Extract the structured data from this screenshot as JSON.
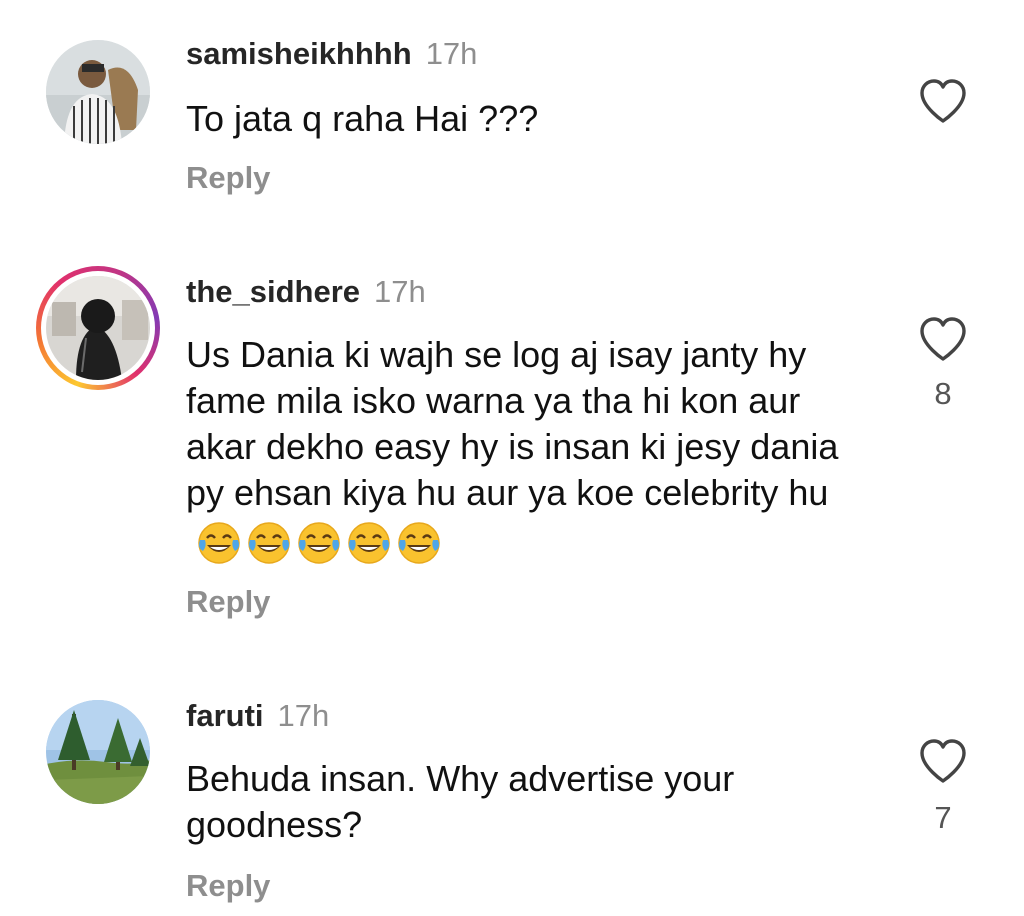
{
  "comments": [
    {
      "username": "samisheikhhhh",
      "time": "17h",
      "text": "To jata q raha Hai ???",
      "reply": "Reply",
      "likes": ""
    },
    {
      "username": "the_sidhere",
      "time": "17h",
      "text": "Us Dania ki wajh se log aj isay janty hy fame mila isko warna ya tha hi kon aur akar dekho easy hy is insan ki jesy dania py ehsan kiya hu aur ya koe celebrity hu",
      "emojis": [
        "😂",
        "😂",
        "😂",
        "😂",
        "😂"
      ],
      "reply": "Reply",
      "likes": "8",
      "has_story_ring": true
    },
    {
      "username": "faruti",
      "time": "17h",
      "text": "Behuda insan. Why advertise your goodness?",
      "reply": "Reply",
      "likes": "7"
    }
  ],
  "icons": {
    "like": "heart-outline-icon",
    "laugh": "face-with-tears-of-joy-icon"
  },
  "colors": {
    "text": "#111111",
    "muted": "#8e8e8e",
    "story_ring_start": "#fdc830",
    "story_ring_end": "#833ab4"
  }
}
